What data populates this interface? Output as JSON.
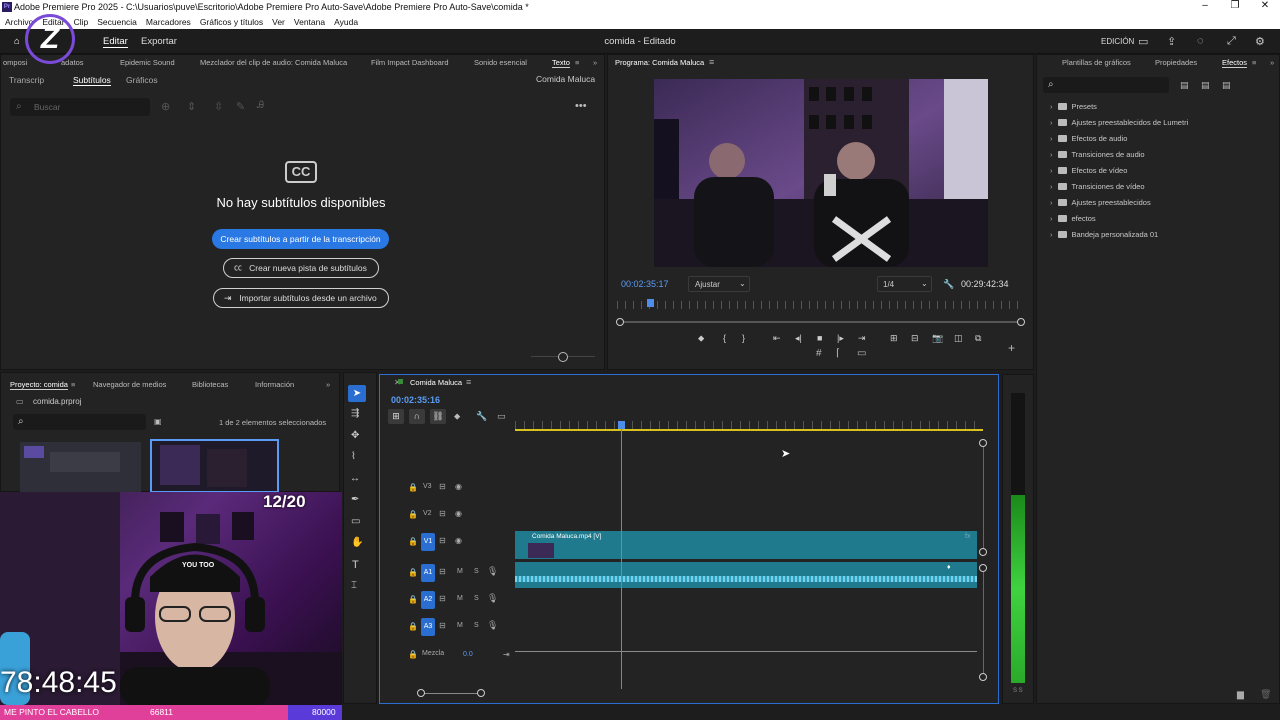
{
  "window": {
    "title": "Adobe Premiere Pro 2025 - C:\\Usuarios\\puve\\Escritorio\\Adobe Premiere Pro Auto-Save\\Adobe Premiere Pro Auto-Save\\comida *",
    "app_badge": "Pr"
  },
  "menu": [
    "Archivo",
    "Editar",
    "Clip",
    "Secuencia",
    "Marcadores",
    "Gráficos y títulos",
    "Ver",
    "Ventana",
    "Ayuda"
  ],
  "topbar": {
    "tab_edit": "Editar",
    "tab_export": "Exportar",
    "project_status": "comida - Editado",
    "workspace": "EDICIÓN"
  },
  "text_panel": {
    "tabs": [
      "omposi",
      "adatos",
      "Epidemic Sound",
      "Mezclador del clip de audio: Comida Maluca",
      "Film Impact Dashboard",
      "Sonido esencial",
      "Texto"
    ],
    "subtabs": [
      "Transcrip",
      "Subtítulos",
      "Gráficos"
    ],
    "sequence": "Comida Maluca",
    "search_placeholder": "Buscar",
    "cc_badge": "CC",
    "empty_title": "No hay subtítulos disponibles",
    "btn_create_from_transcript": "Crear subtítulos a partir de la transcripción",
    "btn_new_track": "Crear nueva pista de subtítulos",
    "btn_import": "Importar subtítulos desde un archivo"
  },
  "program_monitor": {
    "title": "Programa: Comida Maluca",
    "timecode": "00:02:35:17",
    "fit": "Ajustar",
    "resolution": "1/4",
    "duration": "00:29:42:34",
    "playhead_fraction": 0.08
  },
  "project_panel": {
    "tabs": [
      "Proyecto: comida",
      "Navegador de medios",
      "Bibliotecas",
      "Información"
    ],
    "file": "comida.prproj",
    "selection_count": "1 de 2 elementos seleccionados"
  },
  "timeline": {
    "sequence_name": "Comida Maluca",
    "timecode": "00:02:35:16",
    "playhead_fraction": 0.23,
    "video_tracks": [
      "V3",
      "V2",
      "V1"
    ],
    "audio_tracks": [
      "A1",
      "A2",
      "A3"
    ],
    "mix_label": "Mezcla",
    "mix_value": "0.0",
    "clip_name": "Comida Maluca.mp4 [V]",
    "track_toggles": {
      "m": "M",
      "s": "S"
    }
  },
  "effects_panel": {
    "tabs": [
      "Plantillas de gráficos",
      "Propiedades",
      "Efectos"
    ],
    "items": [
      "Presets",
      "Ajustes preestablecidos de Lumetri",
      "Efectos de audio",
      "Transiciones de audio",
      "Efectos de vídeo",
      "Transiciones de vídeo",
      "Ajustes preestablecidos",
      "efectos",
      "Bandeja personalizada 01"
    ]
  },
  "audio_meter": {
    "scale": "S S",
    "level_fraction": 0.65
  },
  "overlay": {
    "counter": "12/20",
    "timer": "78:48:45",
    "ticker": "ME PINTO EL CABELLO",
    "ticker_count": "66811",
    "ticker_goal": "80000",
    "cap_text": "YOU TOO"
  },
  "colors": {
    "accent_blue": "#2a78e4",
    "playhead": "#4d8fe8",
    "clip_teal": "#1e7a8c",
    "meter_green": "#3fd23f",
    "ticker_pink": "#e0409a"
  }
}
